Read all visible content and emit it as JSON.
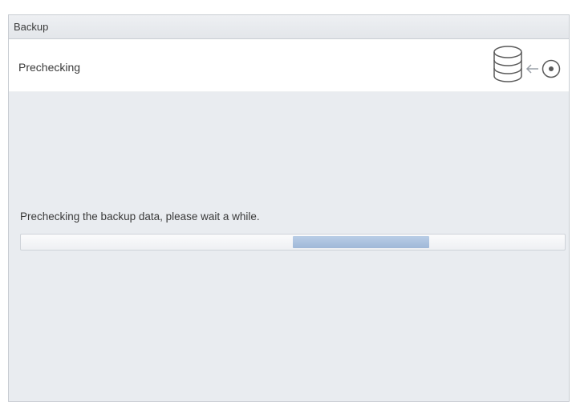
{
  "window": {
    "title": "Backup"
  },
  "header": {
    "label": "Prechecking"
  },
  "icons": {
    "database": "database-icon",
    "arrow": "arrow-left-icon",
    "target": "target-circle-icon"
  },
  "status": {
    "message": "Prechecking the backup data, please wait a while."
  },
  "progress": {
    "mode": "indeterminate",
    "marquee_start_fraction": 0.5,
    "marquee_end_fraction": 0.75
  },
  "colors": {
    "background": "#e9ecf0",
    "marquee": "#a8bfdd"
  }
}
